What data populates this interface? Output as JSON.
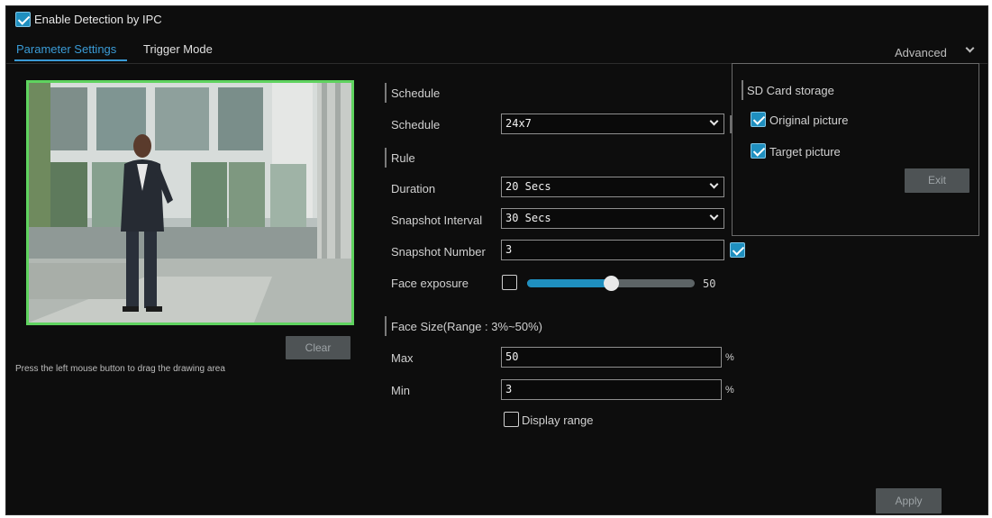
{
  "header": {
    "enable_detection_label": "Enable Detection by IPC",
    "enable_detection_checked": true
  },
  "tabs": [
    {
      "label": "Parameter Settings",
      "active": true
    },
    {
      "label": "Trigger Mode",
      "active": false
    }
  ],
  "advanced": {
    "label": "Advanced"
  },
  "preview": {
    "clear_label": "Clear",
    "hint": "Press the left mouse button to drag the drawing area"
  },
  "schedule": {
    "section_title": "Schedule",
    "label": "Schedule",
    "value": "24x7"
  },
  "rule": {
    "section_title": "Rule",
    "duration_label": "Duration",
    "duration_value": "20 Secs",
    "snapshot_interval_label": "Snapshot Interval",
    "snapshot_interval_value": "30 Secs",
    "snapshot_number_label": "Snapshot Number",
    "snapshot_number_value": "3",
    "face_exposure_label": "Face exposure",
    "face_exposure_checked": false,
    "face_exposure_value": "50",
    "face_exposure_fraction": 0.5
  },
  "face_size": {
    "section_title": "Face Size(Range : 3%~50%)",
    "max_label": "Max",
    "max_value": "50",
    "min_label": "Min",
    "min_value": "3",
    "unit": "%",
    "display_range_label": "Display range",
    "display_range_checked": false
  },
  "sd_popup": {
    "title": "SD Card storage",
    "original_label": "Original picture",
    "original_checked": true,
    "target_label": "Target picture",
    "target_checked": true,
    "exit_label": "Exit"
  },
  "footer": {
    "apply_label": "Apply"
  },
  "colors": {
    "accent": "#1f8fbf",
    "active_tab": "#3a9bd6",
    "detection_border": "#5fd35f",
    "slider_fill": "#1f8fbf",
    "button_bg": "#4e5355"
  }
}
